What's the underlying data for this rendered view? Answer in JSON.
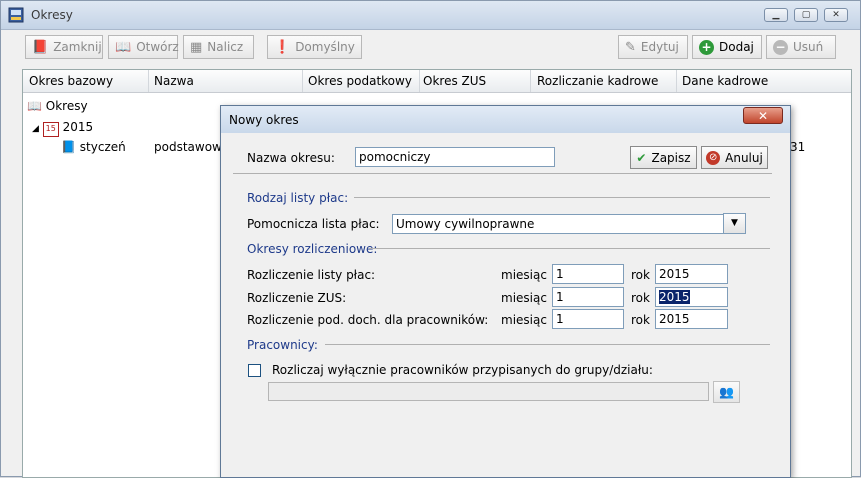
{
  "window": {
    "title": "Okresy"
  },
  "toolbar": {
    "close": "Zamknij",
    "open": "Otwórz",
    "calc": "Nalicz",
    "default": "Domyślny",
    "edit": "Edytuj",
    "add": "Dodaj",
    "delete": "Usuń"
  },
  "table": {
    "headers": [
      "Okres bazowy",
      "Nazwa",
      "Okres podatkowy",
      "Okres ZUS",
      "Rozliczanie kadrowe",
      "Dane kadrowe"
    ],
    "tree": {
      "root": "Okresy",
      "year": "2015",
      "period": "styczeń",
      "period_name": "podstawowy",
      "partial": "31"
    }
  },
  "dialog": {
    "title": "Nowy okres",
    "name_label": "Nazwa okresu:",
    "name_value": "pomocniczy",
    "save": "Zapisz",
    "cancel": "Anuluj",
    "section_type": "Rodzaj listy płac:",
    "aux_label": "Pomocnicza lista płac:",
    "aux_value": "Umowy cywilnoprawne",
    "section_periods": "Okresy rozliczeniowe:",
    "rows": [
      {
        "label": "Rozliczenie listy płac:",
        "month_label": "miesiąc",
        "month": "1",
        "year_label": "rok",
        "year": "2015"
      },
      {
        "label": "Rozliczenie ZUS:",
        "month_label": "miesiąc",
        "month": "1",
        "year_label": "rok",
        "year": "2015"
      },
      {
        "label": "Rozliczenie pod. doch. dla pracowników:",
        "month_label": "miesiąc",
        "month": "1",
        "year_label": "rok",
        "year": "2015"
      }
    ],
    "section_workers": "Pracownicy:",
    "checkbox_label": "Rozliczaj wyłącznie pracowników przypisanych do grupy/działu:"
  }
}
